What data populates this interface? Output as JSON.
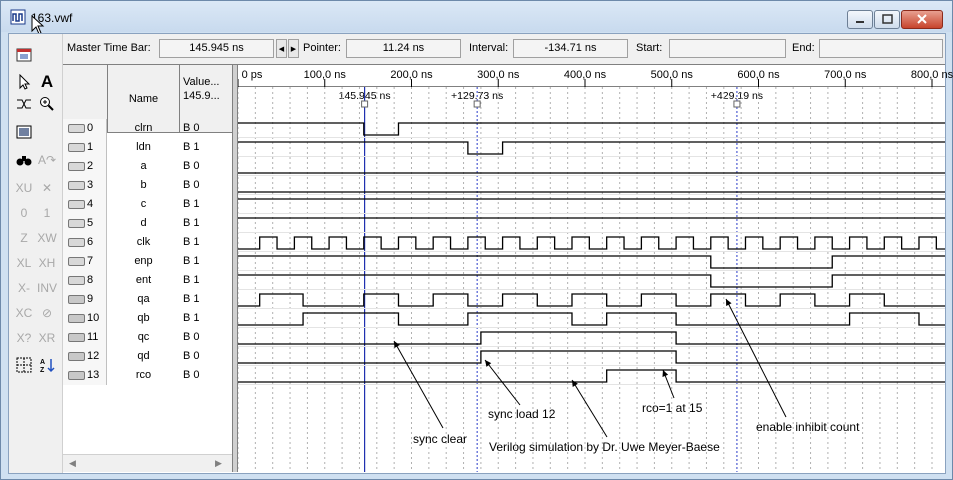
{
  "window": {
    "title": "163.vwf"
  },
  "infobar": {
    "master_label": "Master Time Bar:",
    "master_value": "145.945 ns",
    "pointer_label": "Pointer:",
    "pointer_value": "11.24 ns",
    "interval_label": "Interval:",
    "interval_value": "-134.71 ns",
    "start_label": "Start:",
    "start_value": "",
    "end_label": "End:",
    "end_value": ""
  },
  "columns": {
    "name": "Name",
    "value_line1": "Value...",
    "value_line2": "145.9..."
  },
  "signals": [
    {
      "index": "0",
      "name": "clrn",
      "value": "B 0",
      "io": "in"
    },
    {
      "index": "1",
      "name": "ldn",
      "value": "B 1",
      "io": "in"
    },
    {
      "index": "2",
      "name": "a",
      "value": "B 0",
      "io": "in"
    },
    {
      "index": "3",
      "name": "b",
      "value": "B 0",
      "io": "in"
    },
    {
      "index": "4",
      "name": "c",
      "value": "B 1",
      "io": "in"
    },
    {
      "index": "5",
      "name": "d",
      "value": "B 1",
      "io": "in"
    },
    {
      "index": "6",
      "name": "clk",
      "value": "B 1",
      "io": "in"
    },
    {
      "index": "7",
      "name": "enp",
      "value": "B 1",
      "io": "in"
    },
    {
      "index": "8",
      "name": "ent",
      "value": "B 1",
      "io": "in"
    },
    {
      "index": "9",
      "name": "qa",
      "value": "B 1",
      "io": "out"
    },
    {
      "index": "10",
      "name": "qb",
      "value": "B 1",
      "io": "out"
    },
    {
      "index": "11",
      "name": "qc",
      "value": "B 0",
      "io": "out"
    },
    {
      "index": "12",
      "name": "qd",
      "value": "B 0",
      "io": "out"
    },
    {
      "index": "13",
      "name": "rco",
      "value": "B 0",
      "io": "out"
    }
  ],
  "timeline": {
    "ticks": [
      "0 ps",
      "100,0 ns",
      "200,0 ns",
      "300,0 ns",
      "400,0 ns",
      "500,0 ns",
      "600,0 ns",
      "700,0 ns",
      "800,0 ns"
    ],
    "tick_times_ns": [
      0,
      100,
      200,
      300,
      400,
      500,
      600,
      700,
      800
    ],
    "cursors": [
      {
        "label": "145.945 ns",
        "time_ns": 145.945,
        "color": "#1f2fb0"
      },
      {
        "label": "+129.73 ns",
        "time_ns": 275.675,
        "color": "#2a3cc8"
      },
      {
        "label": "+429.19 ns",
        "time_ns": 575.135,
        "color": "#2a3cc8"
      }
    ]
  },
  "waveforms": {
    "time_end_ns": 805,
    "clrn": {
      "initial": 1,
      "edges": [
        145,
        185
      ]
    },
    "ldn": {
      "initial": 1,
      "edges": [
        265,
        305
      ]
    },
    "a": {
      "initial": 0,
      "edges": []
    },
    "b": {
      "initial": 0,
      "edges": []
    },
    "c": {
      "initial": 1,
      "edges": []
    },
    "d": {
      "initial": 1,
      "edges": []
    },
    "clk": {
      "initial": 0,
      "period_ns": 40,
      "first_rise_ns": 25
    },
    "enp": {
      "initial": 1,
      "edges": [
        545,
        685
      ]
    },
    "ent": {
      "initial": 1,
      "edges": [
        545,
        685
      ]
    },
    "qa": {
      "initial": 0,
      "edges": [
        25,
        75,
        145,
        185,
        225,
        265,
        305,
        345,
        385,
        425,
        465,
        505,
        545,
        585,
        625,
        665,
        705,
        745
      ]
    },
    "qb": {
      "initial": 0,
      "edges": [
        75,
        185,
        265,
        385,
        425,
        505,
        705,
        785
      ]
    },
    "qc": {
      "initial": 0,
      "edges": [
        280,
        505
      ]
    },
    "qd": {
      "initial": 0,
      "edges": [
        280,
        505
      ]
    },
    "rco": {
      "initial": 0,
      "edges": [
        425,
        505
      ]
    }
  },
  "annotations": {
    "sync_clear": "sync clear",
    "sync_load": "sync load 12",
    "rco_label": "rco=1 at 15",
    "enable_inhibit": "enable inhibit count",
    "credit": "Verilog simulation by Dr. Uwe Meyer-Baese"
  },
  "colors": {
    "waveform": "#000000",
    "cursor_master": "#1f2fb0",
    "cursor": "#2a3cc8",
    "grid": "#b0b0b0"
  },
  "icons": [
    "app-icon",
    "minimize-icon",
    "maximize-icon",
    "close-icon"
  ]
}
